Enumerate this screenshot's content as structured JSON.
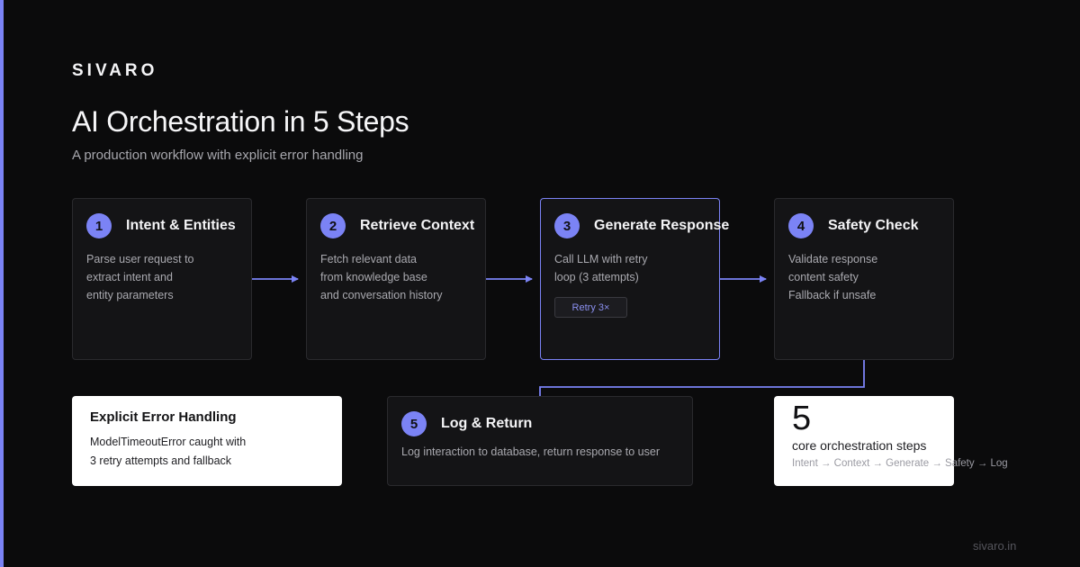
{
  "brand": "SIVARO",
  "title": "AI Orchestration in 5 Steps",
  "subtitle": "A production workflow with explicit error handling",
  "steps": [
    {
      "number": "1",
      "title": "Intent & Entities",
      "lines": [
        "Parse user request to",
        "extract intent and",
        "entity parameters"
      ]
    },
    {
      "number": "2",
      "title": "Retrieve Context",
      "lines": [
        "Fetch relevant data",
        "from knowledge base",
        "and conversation history"
      ]
    },
    {
      "number": "3",
      "title": "Generate Response",
      "lines": [
        "Call LLM with retry",
        "loop (3 attempts)"
      ],
      "badge": "Retry 3×"
    },
    {
      "number": "4",
      "title": "Safety Check",
      "lines": [
        "Validate response",
        "content safety",
        "Fallback if unsafe"
      ]
    },
    {
      "number": "5",
      "title": "Log & Return",
      "lines": [
        "Log interaction to database, return response to user"
      ]
    }
  ],
  "error_card": {
    "title": "Explicit Error Handling",
    "lines": [
      "ModelTimeoutError caught with",
      "3 retry attempts and fallback"
    ]
  },
  "stat_card": {
    "value": "5",
    "label": "core orchestration steps",
    "flow": "Intent → Context → Generate → Safety → Log"
  },
  "footer_domain": "sivaro.in",
  "colors": {
    "accent": "#7b83f5",
    "background": "#0b0b0c",
    "card": "#141416",
    "card_border": "#2a2a2e"
  }
}
